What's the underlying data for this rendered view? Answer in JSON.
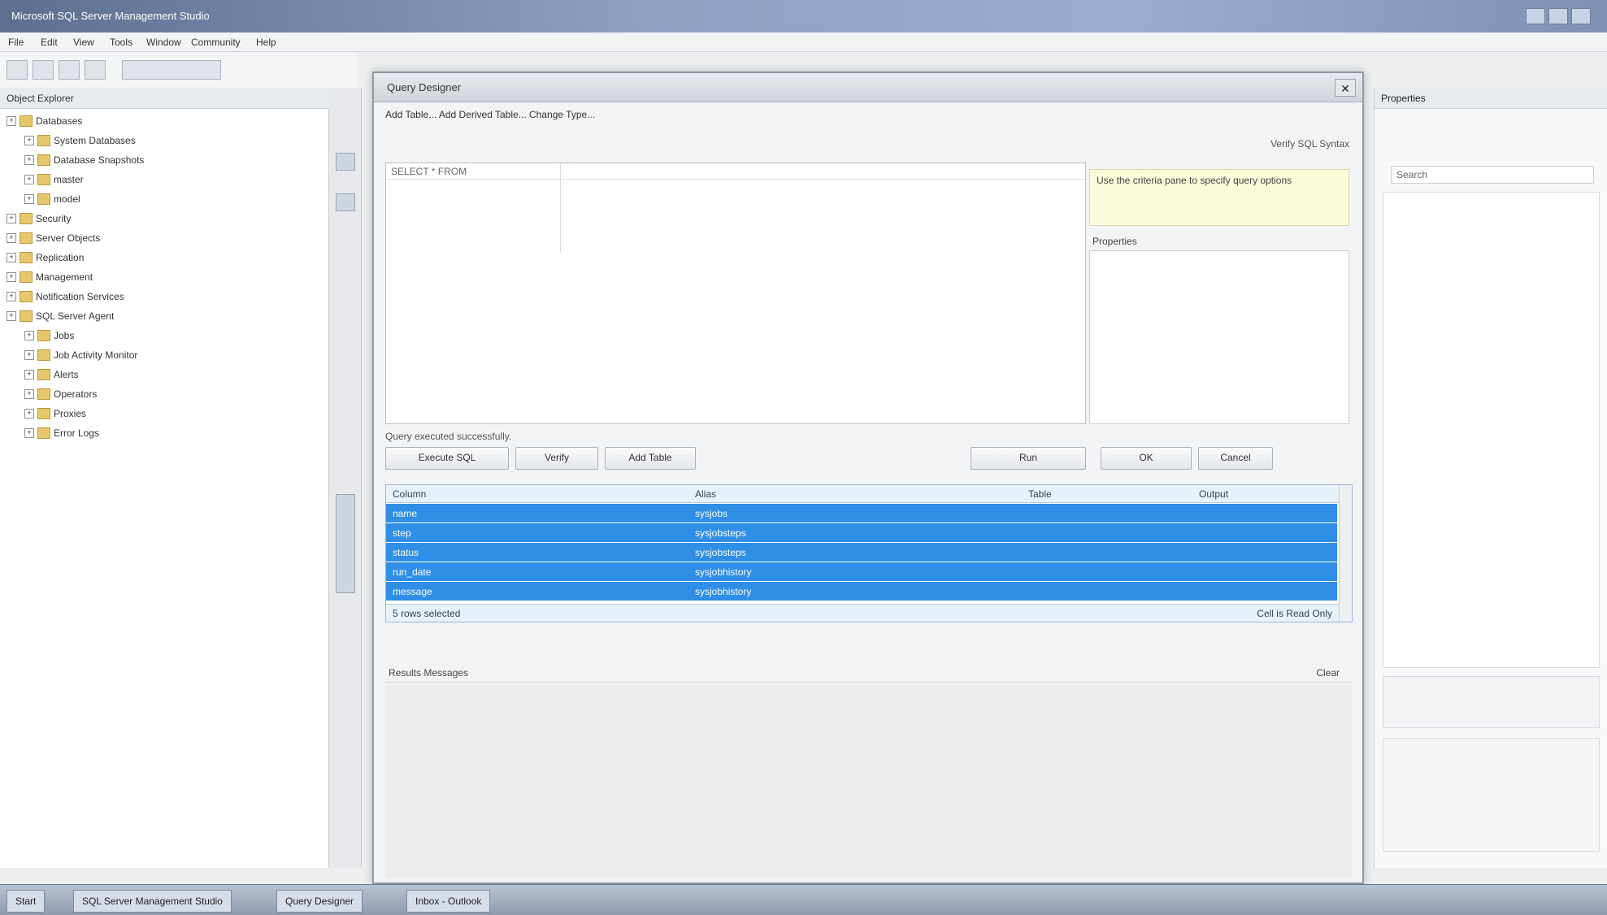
{
  "window": {
    "title": "Microsoft SQL Server Management Studio"
  },
  "menubar": {
    "items": [
      "File",
      "Edit",
      "View",
      "Tools",
      "Window",
      "Community",
      "Help"
    ]
  },
  "left_panel": {
    "header": "Object Explorer",
    "tree": [
      {
        "label": "Databases",
        "level": 0
      },
      {
        "label": "System Databases",
        "level": 1
      },
      {
        "label": "Database Snapshots",
        "level": 1
      },
      {
        "label": "master",
        "level": 1
      },
      {
        "label": "model",
        "level": 1
      },
      {
        "label": "Security",
        "level": 0
      },
      {
        "label": "Server Objects",
        "level": 0
      },
      {
        "label": "Replication",
        "level": 0
      },
      {
        "label": "Management",
        "level": 0
      },
      {
        "label": "Notification Services",
        "level": 0
      },
      {
        "label": "SQL Server Agent",
        "level": 0
      },
      {
        "label": "Jobs",
        "level": 1
      },
      {
        "label": "Job Activity Monitor",
        "level": 1
      },
      {
        "label": "Alerts",
        "level": 1
      },
      {
        "label": "Operators",
        "level": 1
      },
      {
        "label": "Proxies",
        "level": 1
      },
      {
        "label": "Error Logs",
        "level": 1
      }
    ]
  },
  "dialog": {
    "title": "Query Designer",
    "subheader": "Add Table... Add Derived Table... Change Type...",
    "options_link": "Verify SQL Syntax",
    "editor_hint": "SELECT *  FROM",
    "help_text": "Use the criteria pane to specify query options",
    "help_label": "Properties",
    "status_line": "Query executed successfully.",
    "buttons": {
      "execute": "Execute SQL",
      "verify": "Verify",
      "add_table": "Add Table",
      "run": "Run",
      "ok": "OK",
      "cancel": "Cancel"
    },
    "grid": {
      "headers": [
        "Column",
        "Alias",
        "Table",
        "Output"
      ],
      "rows": [
        {
          "c1": "name",
          "c2": "sysjobs"
        },
        {
          "c1": "step",
          "c2": "sysjobsteps"
        },
        {
          "c1": "status",
          "c2": "sysjobsteps"
        },
        {
          "c1": "run_date",
          "c2": "sysjobhistory"
        },
        {
          "c1": "message",
          "c2": "sysjobhistory"
        }
      ],
      "footer": "5 rows selected",
      "footer_right": "Cell is Read Only"
    },
    "bottom_bar": "Results    Messages",
    "bottom_right": "Clear"
  },
  "right_panel": {
    "header": "Properties",
    "search_placeholder": "Search"
  },
  "taskbar": {
    "items": [
      "Start",
      "SQL Server Management Studio",
      "Query Designer",
      "Inbox - Outlook"
    ]
  }
}
